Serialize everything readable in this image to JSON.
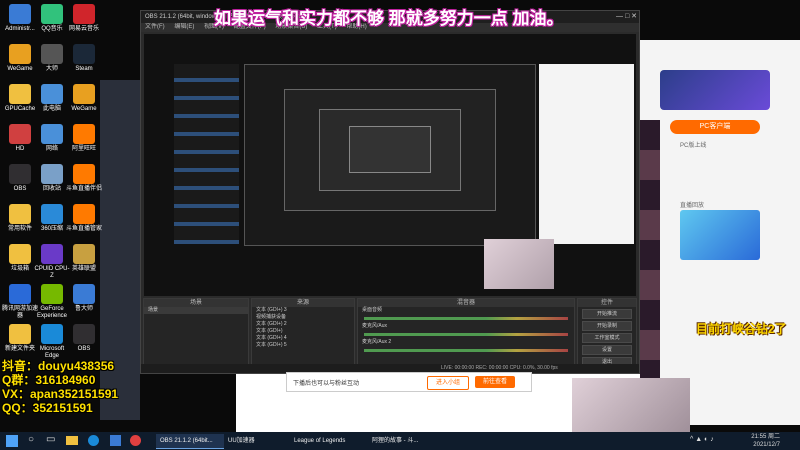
{
  "overlay": {
    "top_banner": "如果运气和实力都不够 那就多努力一点 加油。",
    "right_note": "目前打峡谷钻2了",
    "left_lines": [
      "抖音：douyu438356",
      "Q群：316184960",
      "VX：apan352151591",
      "QQ：352151591"
    ]
  },
  "desktop_icons": [
    {
      "label": "Administr...",
      "color": "#3a7bd5"
    },
    {
      "label": "QQ音乐",
      "color": "#31c27c"
    },
    {
      "label": "网易云音乐",
      "color": "#d0252b"
    },
    {
      "label": "WeGame",
      "color": "#e8a020"
    },
    {
      "label": "大师",
      "color": "#555"
    },
    {
      "label": "Steam",
      "color": "#1b2838"
    },
    {
      "label": "GPUCache",
      "color": "#f0c040"
    },
    {
      "label": "此电脑",
      "color": "#4a90d9"
    },
    {
      "label": "WeGame",
      "color": "#e8a020"
    },
    {
      "label": "HD",
      "color": "#d04040"
    },
    {
      "label": "网络",
      "color": "#4a90d9"
    },
    {
      "label": "阿里旺旺",
      "color": "#ff7a00"
    },
    {
      "label": "OBS",
      "color": "#302e31"
    },
    {
      "label": "回收站",
      "color": "#7aa0c8"
    },
    {
      "label": "斗鱼直播伴侣",
      "color": "#ff7a00"
    },
    {
      "label": "常用软件",
      "color": "#f0c040"
    },
    {
      "label": "360压缩",
      "color": "#2a8ad8"
    },
    {
      "label": "斗鱼直播管家",
      "color": "#ff7a00"
    },
    {
      "label": "垃圾箱",
      "color": "#f0c040"
    },
    {
      "label": "CPUID CPU-Z",
      "color": "#6a3ac8"
    },
    {
      "label": "英雄联盟",
      "color": "#c8a040"
    },
    {
      "label": "腾讯网游加速器",
      "color": "#2a6ad8"
    },
    {
      "label": "GeForce Experience",
      "color": "#76b900"
    },
    {
      "label": "鲁大师",
      "color": "#3a7bd5"
    },
    {
      "label": "新建文件夹",
      "color": "#f0c040"
    },
    {
      "label": "Microsoft Edge",
      "color": "#1a8ad8"
    },
    {
      "label": "OBS",
      "color": "#302e31"
    },
    {
      "label": "QQ",
      "color": "#1aa0e0"
    }
  ],
  "obs": {
    "title": "OBS 21.1.2 (64bit, windows) - 配置文件: 未命名 - 场景: 未命名",
    "menu": [
      "文件(F)",
      "编辑(E)",
      "视图(V)",
      "配置文件(P)",
      "场景集合(S)",
      "工具(T)",
      "帮助(H)"
    ],
    "docks": {
      "scenes": {
        "title": "场景",
        "items": [
          "场景"
        ]
      },
      "sources": {
        "title": "来源",
        "items": [
          "文本 (GDI+) 3",
          "视频捕获设备",
          "文本 (GDI+) 2",
          "文本 (GDI+)",
          "文本 (GDI+) 4",
          "文本 (GDI+) 5"
        ]
      },
      "mixer": {
        "title": "混音器",
        "items": [
          "桌面音频",
          "麦克风/Aux",
          "麦克风/Aux 2"
        ]
      },
      "controls": {
        "title": "控件",
        "buttons": [
          "开始推流",
          "开始录制",
          "工作室模式",
          "设置",
          "退出"
        ]
      }
    },
    "status": "LIVE: 00:00:00   REC: 00:00:00   CPU: 0.0%, 30.00 fps"
  },
  "notice": {
    "text": "下播后也可以与粉丝互动",
    "btn1": "进入小组",
    "btn2": "前往查看"
  },
  "taskbar": {
    "items": [
      "OBS 21.1.2 (64bit...",
      "UU加速器",
      "League of Legends",
      "阿狸的故事 - 斗..."
    ],
    "time": "21:55",
    "date": "2021/12/7",
    "weekday": "周二"
  },
  "right_panel": {
    "pc_badge": "PC客户端",
    "side_text": [
      "PC版上线",
      "直播回放"
    ]
  }
}
